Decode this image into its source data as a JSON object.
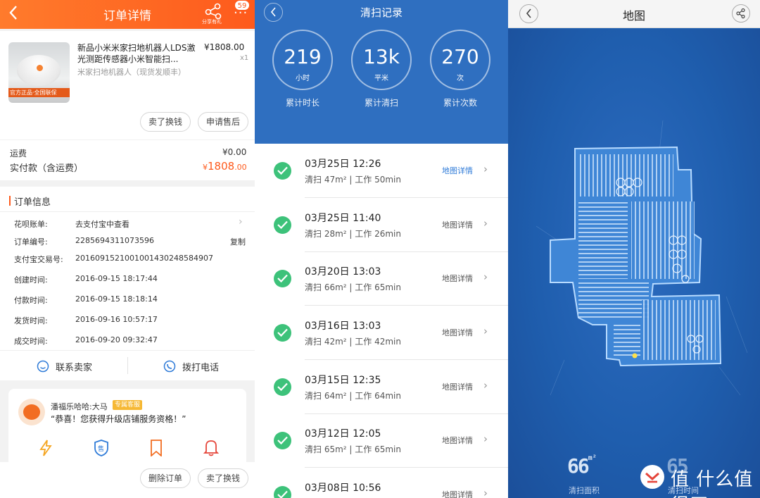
{
  "order": {
    "header": {
      "title": "订单详情",
      "share_label": "分享有礼",
      "badge": "59"
    },
    "product": {
      "name": "新品小米米家扫地机器人LDS激光测距传感器小米智能扫...",
      "subtitle": "米家扫地机器人（现货发顺丰）",
      "price": "¥1808.00",
      "qty": "x1",
      "image_tag": "官方正品·全国联保"
    },
    "buttons": {
      "sell": "卖了换钱",
      "after_sale": "申请售后",
      "delete": "删除订单",
      "sell2": "卖了换钱"
    },
    "shipping": {
      "label": "运费",
      "value": "¥0.00"
    },
    "paid": {
      "label": "实付款（含运费）",
      "currency": "¥",
      "amount": "1808",
      "cents": ".00"
    },
    "info": {
      "title": "订单信息",
      "rows": [
        {
          "key": "花呗账单:",
          "value": "去支付宝中查看"
        },
        {
          "key": "订单编号:",
          "value": "2285694311073596",
          "action": "复制"
        },
        {
          "key": "支付宝交易号:",
          "value": "2016091521001001430248584907"
        },
        {
          "key": "创建时间:",
          "value": "2016-09-15 18:17:44"
        },
        {
          "key": "付款时间:",
          "value": "2016-09-15 18:18:14"
        },
        {
          "key": "发货时间:",
          "value": "2016-09-16 10:57:17"
        },
        {
          "key": "成交时间:",
          "value": "2016-09-20 09:32:47"
        }
      ]
    },
    "contact": {
      "seller": "联系卖家",
      "call": "拨打电话"
    },
    "service": {
      "name": "潘福乐哈哈:大马",
      "tag": "专属客服",
      "message": "“恭喜！您获得升级店铺服务资格！”"
    }
  },
  "records": {
    "header": {
      "title": "清扫记录"
    },
    "stats": [
      {
        "value": "219",
        "unit": "小时",
        "label": "累计时长"
      },
      {
        "value": "13k",
        "unit": "平米",
        "label": "累计清扫"
      },
      {
        "value": "270",
        "unit": "次",
        "label": "累计次数"
      }
    ],
    "link_label": "地图详情",
    "items": [
      {
        "date": "03月25日 12:26",
        "info": "清扫 47m² | 工作 50min"
      },
      {
        "date": "03月25日 11:40",
        "info": "清扫 28m² | 工作 26min"
      },
      {
        "date": "03月20日 13:03",
        "info": "清扫 66m² | 工作 65min"
      },
      {
        "date": "03月16日 13:03",
        "info": "清扫 42m² | 工作 42min"
      },
      {
        "date": "03月15日 12:35",
        "info": "清扫 64m² | 工作 64min"
      },
      {
        "date": "03月12日 12:05",
        "info": "清扫 65m² | 工作 65min"
      },
      {
        "date": "03月08日 10:56",
        "info": ""
      }
    ]
  },
  "map": {
    "header": {
      "title": "地图"
    },
    "area": {
      "value": "66",
      "unit": "m²",
      "label": "清扫面积"
    },
    "time": {
      "value": "65",
      "label": "清扫时间"
    },
    "watermark": "值 什么值得买"
  },
  "colors": {
    "orange": "#fe5a1c",
    "blue_header": "#2f6fc0",
    "green_check": "#3dc27a",
    "map_blue": "#1e5fb0"
  }
}
